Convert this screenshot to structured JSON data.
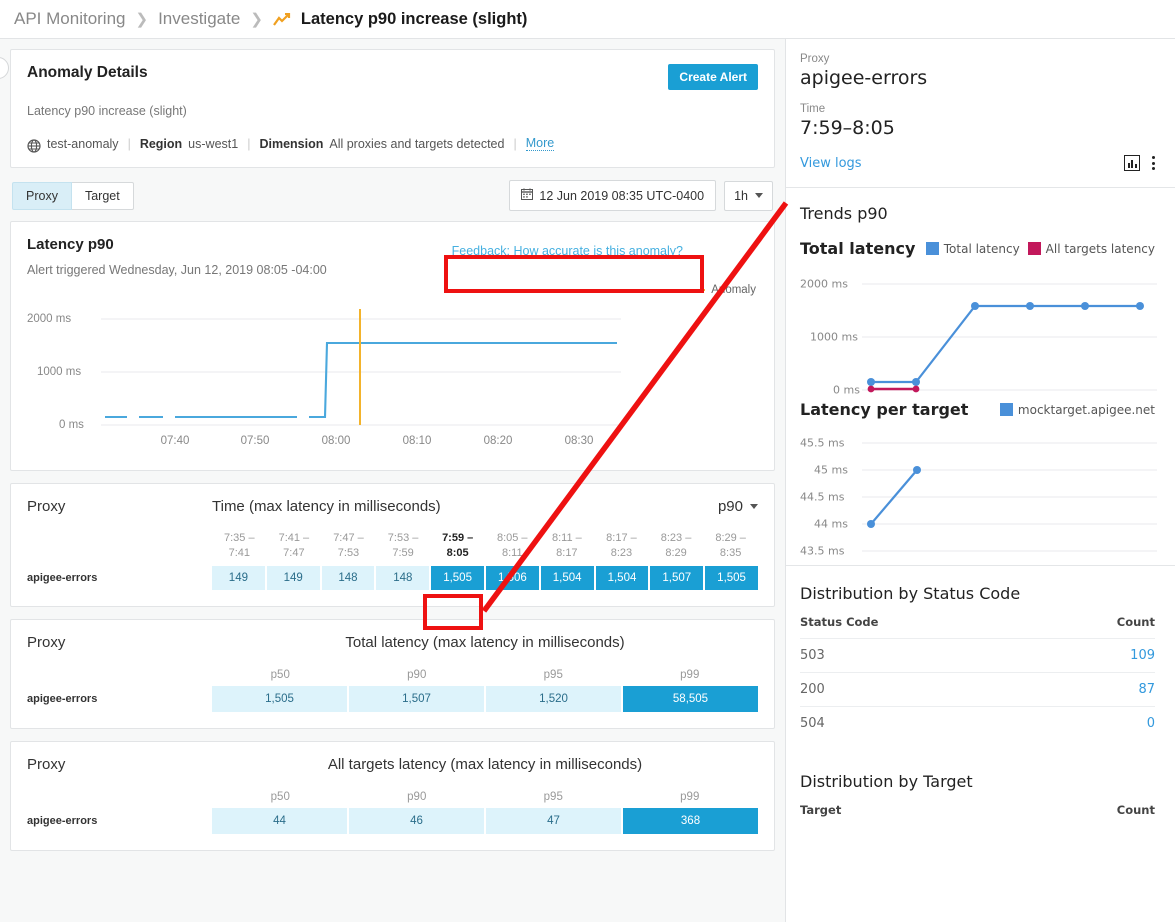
{
  "breadcrumb": {
    "root": "API Monitoring",
    "section": "Investigate",
    "current": "Latency p90 increase (slight)",
    "icon": "trend-up-icon"
  },
  "anomaly": {
    "title": "Anomaly Details",
    "create_alert_label": "Create Alert",
    "description": "Latency p90 increase (slight)",
    "org": "test-anomaly",
    "region_label": "Region",
    "region_value": "us-west1",
    "dimension_label": "Dimension",
    "dimension_value": "All proxies and targets detected",
    "more_label": "More"
  },
  "toolbar": {
    "tabs": [
      {
        "label": "Proxy",
        "active": true
      },
      {
        "label": "Target",
        "active": false
      }
    ],
    "date_value": "12 Jun 2019 08:35 UTC-0400",
    "range_value": "1h"
  },
  "latency_chart": {
    "title": "Latency p90",
    "subtitle": "Alert triggered Wednesday, Jun 12, 2019 08:05 -04:00",
    "feedback_label": "Feedback: How accurate is this anomaly?",
    "anomaly_legend": "Anomaly",
    "highlight_color": "#ee1111"
  },
  "time_table": {
    "col_label": "Proxy",
    "title": "Time (max latency in milliseconds)",
    "percentile": "p90",
    "row_label": "apigee-errors",
    "columns": [
      {
        "from": "7:35 –",
        "to": "7:41",
        "selected": false
      },
      {
        "from": "7:41 –",
        "to": "7:47",
        "selected": false
      },
      {
        "from": "7:47 –",
        "to": "7:53",
        "selected": false
      },
      {
        "from": "7:53 –",
        "to": "7:59",
        "selected": false
      },
      {
        "from": "7:59 –",
        "to": "8:05",
        "selected": true
      },
      {
        "from": "8:05 –",
        "to": "8:11",
        "selected": false
      },
      {
        "from": "8:11 –",
        "to": "8:17",
        "selected": false
      },
      {
        "from": "8:17 –",
        "to": "8:23",
        "selected": false
      },
      {
        "from": "8:23 –",
        "to": "8:29",
        "selected": false
      },
      {
        "from": "8:29 –",
        "to": "8:35",
        "selected": false
      }
    ],
    "values": [
      "149",
      "149",
      "148",
      "148",
      "1,505",
      "1,506",
      "1,504",
      "1,504",
      "1,507",
      "1,505"
    ]
  },
  "total_latency_table": {
    "col_label": "Proxy",
    "title": "Total latency (max latency in milliseconds)",
    "row_label": "apigee-errors",
    "columns": [
      "p50",
      "p90",
      "p95",
      "p99"
    ],
    "values": [
      "1,505",
      "1,507",
      "1,520",
      "58,505"
    ]
  },
  "all_targets_table": {
    "col_label": "Proxy",
    "title": "All targets latency (max latency in milliseconds)",
    "row_label": "apigee-errors",
    "columns": [
      "p50",
      "p90",
      "p95",
      "p99"
    ],
    "values": [
      "44",
      "46",
      "47",
      "368"
    ]
  },
  "right_panel": {
    "proxy_label": "Proxy",
    "proxy_value": "apigee-errors",
    "time_label": "Time",
    "time_value": "7:59–8:05",
    "view_logs_label": "View logs",
    "chart_icon": "bar-chart-icon",
    "menu_icon": "kebab-menu-icon",
    "trends_title": "Trends p90",
    "total_latency_title": "Total latency",
    "legend": [
      {
        "label": "Total latency",
        "color": "#4a90d9"
      },
      {
        "label": "All targets latency",
        "color": "#c2185b"
      }
    ],
    "per_target_title": "Latency per target",
    "per_target_legend": [
      {
        "label": "mocktarget.apigee.net",
        "color": "#4a90d9"
      }
    ],
    "status_dist_title": "Distribution by Status Code",
    "status_columns": [
      "Status Code",
      "Count"
    ],
    "status_rows": [
      {
        "code": "503",
        "count": "109"
      },
      {
        "code": "200",
        "count": "87"
      },
      {
        "code": "504",
        "count": "0"
      }
    ],
    "target_dist_title": "Distribution by Target",
    "target_columns": [
      "Target",
      "Count"
    ]
  },
  "chart_data": [
    {
      "id": "latency_p90_main",
      "type": "line",
      "title": "Latency p90",
      "xlabel": "",
      "ylabel": "",
      "ylim": [
        0,
        2400
      ],
      "yticks": [
        0,
        1000,
        2000
      ],
      "ytick_labels": [
        "0 ms",
        "1000 ms",
        "2000 ms"
      ],
      "xtick_labels": [
        "07:40",
        "07:50",
        "08:00",
        "08:10",
        "08:20",
        "08:30"
      ],
      "grid": true,
      "series": [
        {
          "name": "Latency p90",
          "color": "#4aa8dd",
          "x": [
            "07:35",
            "07:40",
            "07:45",
            "07:50",
            "07:55",
            "07:58",
            "08:00",
            "08:01",
            "08:05",
            "08:10",
            "08:15",
            "08:20",
            "08:25",
            "08:30",
            "08:35"
          ],
          "values": [
            149,
            149,
            148,
            148,
            148,
            148,
            149,
            1505,
            1506,
            1504,
            1504,
            1507,
            1505,
            1505,
            1505
          ]
        }
      ],
      "annotations": [
        {
          "type": "vline",
          "label": "Anomaly",
          "x": "08:05",
          "color": "#f3b32b"
        }
      ]
    },
    {
      "id": "trends_total_latency",
      "type": "line",
      "title": "Total latency",
      "ylim": [
        0,
        2400
      ],
      "yticks": [
        0,
        1000,
        2000
      ],
      "ytick_labels": [
        "0 ms",
        "1000 ms",
        "2000 ms"
      ],
      "grid": true,
      "legend_position": "top-right",
      "series": [
        {
          "name": "Total latency",
          "color": "#4a90d9",
          "values": [
            150,
            160,
            1505,
            1507,
            1504,
            1505
          ]
        },
        {
          "name": "All targets latency",
          "color": "#c2185b",
          "values": [
            44,
            46
          ]
        }
      ]
    },
    {
      "id": "latency_per_target",
      "type": "line",
      "title": "Latency per target",
      "ylim": [
        43.5,
        45.5
      ],
      "yticks": [
        43.5,
        44,
        44.5,
        45,
        45.5
      ],
      "ytick_labels": [
        "43.5 ms",
        "44 ms",
        "44.5 ms",
        "45 ms",
        "45.5 ms"
      ],
      "grid": true,
      "legend_position": "top-right",
      "series": [
        {
          "name": "mocktarget.apigee.net",
          "color": "#4a90d9",
          "values": [
            44,
            45
          ]
        }
      ]
    }
  ]
}
